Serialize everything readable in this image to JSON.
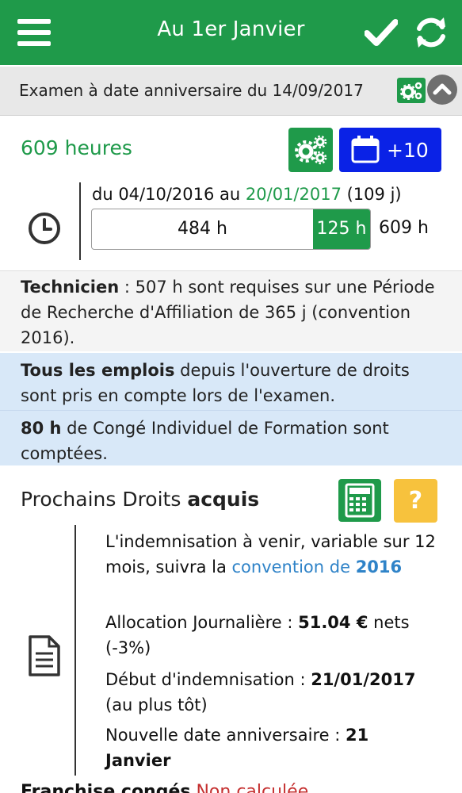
{
  "appbar": {
    "title": "Au 1er Janvier"
  },
  "exam_bar": {
    "text": "Examen à date anniversaire du 14/09/2017"
  },
  "summary": {
    "hours": "609 heures",
    "add_label": "+10",
    "period_prefix": "du 04/10/2016 au ",
    "period_end": "20/01/2017",
    "period_suffix": " (109 j)",
    "base_hours": "484 h",
    "extra_hours": "125 h",
    "total_hours": "609 h",
    "progress_fraction": 0.795
  },
  "technician": {
    "bold": "Technicien",
    "text": " : 507 h sont requises sur une Période de Recherche d'Affiliation de 365 j (convention 2016)."
  },
  "info1": {
    "bold": "Tous les emplois",
    "text": " depuis l'ouverture de droits sont pris en compte lors de l'examen."
  },
  "info2": {
    "bold": "80 h",
    "text": " de Congé Individuel de Formation sont comptées."
  },
  "rights": {
    "title_prefix": "Prochains Droits ",
    "title_bold": "acquis",
    "help_label": "?",
    "line1_text": "L'indemnisation à venir, variable sur 12 mois, suivra la ",
    "line1_link": "convention de ",
    "line1_link_bold": "2016",
    "line2_text": "Allocation Journalière : ",
    "line2_bold": "51.04 €",
    "line2_suffix": " nets (-3%)",
    "line3_text": "Début d'indemnisation : ",
    "line3_bold": "21/01/2017",
    "line3_suffix": " (au plus tôt)",
    "line4_text": "Nouvelle date anniversaire : ",
    "line4_bold": "21 Janvier"
  },
  "bottom": {
    "bold": "Franchise congés",
    "red": " Non calculée"
  },
  "colors": {
    "green": "#1f9a4a",
    "blue": "#0a22e6",
    "yellow": "#f7c23d",
    "link": "#2f83c8"
  },
  "icons": [
    "menu-icon",
    "check-icon",
    "refresh-icon",
    "gears-icon",
    "chevron-up-icon",
    "calendar-icon",
    "clock-icon",
    "calculator-icon",
    "document-icon"
  ]
}
